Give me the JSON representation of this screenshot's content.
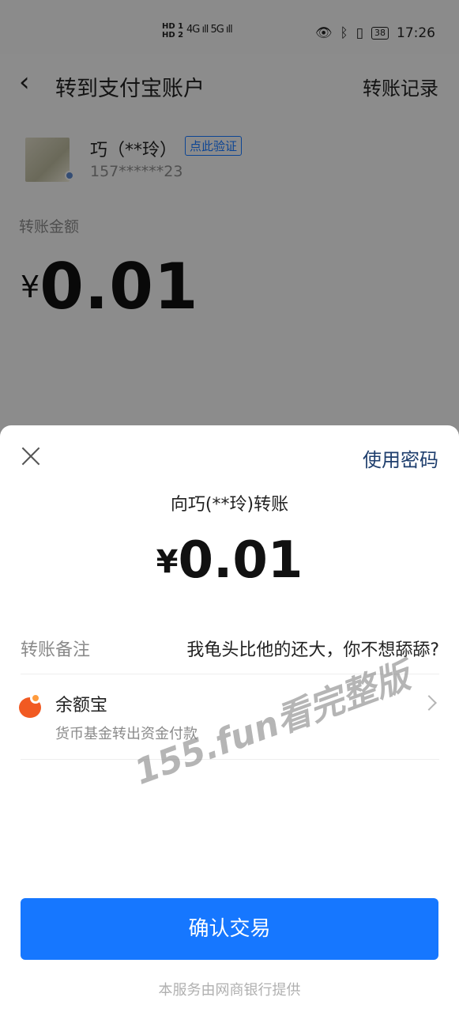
{
  "status_bar": {
    "signal_labels": "HD 1\nHD 2",
    "network": "4G ıll 5G ıll",
    "battery": "38",
    "time": "17:26"
  },
  "nav": {
    "back_icon": "chevron-left-icon",
    "title": "转到支付宝账户",
    "records": "转账记录"
  },
  "payee": {
    "name": "巧（**玲）",
    "verify_tag": "点此验证",
    "phone": "157******23"
  },
  "amount_section": {
    "label": "转账金额",
    "currency": "¥",
    "value": "0.01"
  },
  "sheet": {
    "close_icon": "close-icon",
    "use_password": "使用密码",
    "title": "向巧(**玲)转账",
    "currency": "¥",
    "amount": "0.01",
    "note_label": "转账备注",
    "note_value": "我龟头比他的还大，你不想舔舔?",
    "pay_method": {
      "icon": "yuebao-icon",
      "name": "余额宝",
      "description": "货币基金转出资金付款"
    },
    "confirm_button": "确认交易",
    "footer": "本服务由网商银行提供"
  },
  "watermark": "155.fun看完整版",
  "colors": {
    "accent": "#1677ff",
    "link_dark": "#1e3e6d",
    "yuebao_orange": "#f15a22"
  }
}
